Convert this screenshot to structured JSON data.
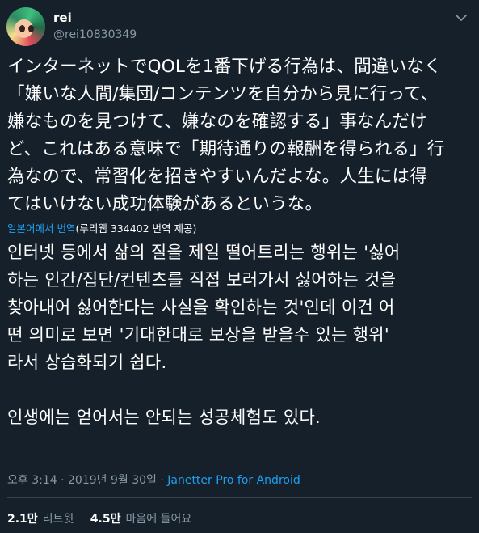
{
  "author": {
    "display_name": "rei",
    "handle": "@rei10830349"
  },
  "tweet": {
    "lines": [
      "インターネットでQOLを1番下げる行為は、間違いなく",
      "「嫌いな人間/集団/コンテンツを自分から見に行って、",
      "嫌なものを見つけて、嫌なのを確認する」事なんだけ",
      "ど、これはある意味で「期待通りの報酬を得られる」行",
      "為なので、常習化を招きやすいんだよな。人生には得",
      "てはいけない成功体験があるというな。"
    ]
  },
  "translation": {
    "link_label": "일본어에서 번역",
    "provider": "(루리웹 334402 번역 제공)",
    "lines": [
      "인터넷 등에서 삶의 질을 제일 떨어트리는 행위는 '싫어",
      "하는 인간/집단/컨텐츠를 직접 보러가서 싫어하는 것을",
      "찾아내어 싫어한다는 사실을 확인하는 것'인데 이건 어",
      "떤 의미로 보면 '기대한대로 보상을 받을수 있는 행위'",
      "라서 상습화되기 쉽다."
    ],
    "lines2": [
      "인생에는 얻어서는 안되는 성공체험도 있다."
    ]
  },
  "meta": {
    "time_date": "오후 3:14 · 2019년 9월 30일 · ",
    "source": "Janetter Pro for Android"
  },
  "stats": {
    "retweets_count": "2.1만",
    "retweets_label": "리트윗",
    "likes_count": "4.5만",
    "likes_label": "마음에 들어요"
  },
  "colors": {
    "background": "#15202b",
    "text": "#ffffff",
    "secondary": "#8899a6",
    "link": "#1da1f2",
    "divider": "#38444d"
  },
  "icons": {
    "more": "chevron-down-icon"
  }
}
